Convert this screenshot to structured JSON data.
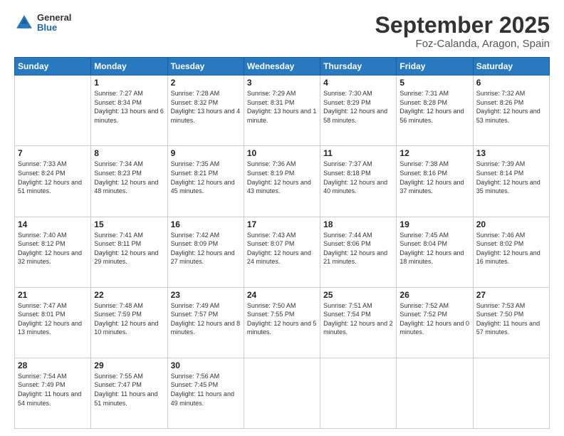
{
  "header": {
    "logo_general": "General",
    "logo_blue": "Blue",
    "month": "September 2025",
    "location": "Foz-Calanda, Aragon, Spain"
  },
  "weekdays": [
    "Sunday",
    "Monday",
    "Tuesday",
    "Wednesday",
    "Thursday",
    "Friday",
    "Saturday"
  ],
  "weeks": [
    [
      {
        "day": "",
        "sunrise": "",
        "sunset": "",
        "daylight": ""
      },
      {
        "day": "1",
        "sunrise": "Sunrise: 7:27 AM",
        "sunset": "Sunset: 8:34 PM",
        "daylight": "Daylight: 13 hours and 6 minutes."
      },
      {
        "day": "2",
        "sunrise": "Sunrise: 7:28 AM",
        "sunset": "Sunset: 8:32 PM",
        "daylight": "Daylight: 13 hours and 4 minutes."
      },
      {
        "day": "3",
        "sunrise": "Sunrise: 7:29 AM",
        "sunset": "Sunset: 8:31 PM",
        "daylight": "Daylight: 13 hours and 1 minute."
      },
      {
        "day": "4",
        "sunrise": "Sunrise: 7:30 AM",
        "sunset": "Sunset: 8:29 PM",
        "daylight": "Daylight: 12 hours and 58 minutes."
      },
      {
        "day": "5",
        "sunrise": "Sunrise: 7:31 AM",
        "sunset": "Sunset: 8:28 PM",
        "daylight": "Daylight: 12 hours and 56 minutes."
      },
      {
        "day": "6",
        "sunrise": "Sunrise: 7:32 AM",
        "sunset": "Sunset: 8:26 PM",
        "daylight": "Daylight: 12 hours and 53 minutes."
      }
    ],
    [
      {
        "day": "7",
        "sunrise": "Sunrise: 7:33 AM",
        "sunset": "Sunset: 8:24 PM",
        "daylight": "Daylight: 12 hours and 51 minutes."
      },
      {
        "day": "8",
        "sunrise": "Sunrise: 7:34 AM",
        "sunset": "Sunset: 8:23 PM",
        "daylight": "Daylight: 12 hours and 48 minutes."
      },
      {
        "day": "9",
        "sunrise": "Sunrise: 7:35 AM",
        "sunset": "Sunset: 8:21 PM",
        "daylight": "Daylight: 12 hours and 45 minutes."
      },
      {
        "day": "10",
        "sunrise": "Sunrise: 7:36 AM",
        "sunset": "Sunset: 8:19 PM",
        "daylight": "Daylight: 12 hours and 43 minutes."
      },
      {
        "day": "11",
        "sunrise": "Sunrise: 7:37 AM",
        "sunset": "Sunset: 8:18 PM",
        "daylight": "Daylight: 12 hours and 40 minutes."
      },
      {
        "day": "12",
        "sunrise": "Sunrise: 7:38 AM",
        "sunset": "Sunset: 8:16 PM",
        "daylight": "Daylight: 12 hours and 37 minutes."
      },
      {
        "day": "13",
        "sunrise": "Sunrise: 7:39 AM",
        "sunset": "Sunset: 8:14 PM",
        "daylight": "Daylight: 12 hours and 35 minutes."
      }
    ],
    [
      {
        "day": "14",
        "sunrise": "Sunrise: 7:40 AM",
        "sunset": "Sunset: 8:12 PM",
        "daylight": "Daylight: 12 hours and 32 minutes."
      },
      {
        "day": "15",
        "sunrise": "Sunrise: 7:41 AM",
        "sunset": "Sunset: 8:11 PM",
        "daylight": "Daylight: 12 hours and 29 minutes."
      },
      {
        "day": "16",
        "sunrise": "Sunrise: 7:42 AM",
        "sunset": "Sunset: 8:09 PM",
        "daylight": "Daylight: 12 hours and 27 minutes."
      },
      {
        "day": "17",
        "sunrise": "Sunrise: 7:43 AM",
        "sunset": "Sunset: 8:07 PM",
        "daylight": "Daylight: 12 hours and 24 minutes."
      },
      {
        "day": "18",
        "sunrise": "Sunrise: 7:44 AM",
        "sunset": "Sunset: 8:06 PM",
        "daylight": "Daylight: 12 hours and 21 minutes."
      },
      {
        "day": "19",
        "sunrise": "Sunrise: 7:45 AM",
        "sunset": "Sunset: 8:04 PM",
        "daylight": "Daylight: 12 hours and 18 minutes."
      },
      {
        "day": "20",
        "sunrise": "Sunrise: 7:46 AM",
        "sunset": "Sunset: 8:02 PM",
        "daylight": "Daylight: 12 hours and 16 minutes."
      }
    ],
    [
      {
        "day": "21",
        "sunrise": "Sunrise: 7:47 AM",
        "sunset": "Sunset: 8:01 PM",
        "daylight": "Daylight: 12 hours and 13 minutes."
      },
      {
        "day": "22",
        "sunrise": "Sunrise: 7:48 AM",
        "sunset": "Sunset: 7:59 PM",
        "daylight": "Daylight: 12 hours and 10 minutes."
      },
      {
        "day": "23",
        "sunrise": "Sunrise: 7:49 AM",
        "sunset": "Sunset: 7:57 PM",
        "daylight": "Daylight: 12 hours and 8 minutes."
      },
      {
        "day": "24",
        "sunrise": "Sunrise: 7:50 AM",
        "sunset": "Sunset: 7:55 PM",
        "daylight": "Daylight: 12 hours and 5 minutes."
      },
      {
        "day": "25",
        "sunrise": "Sunrise: 7:51 AM",
        "sunset": "Sunset: 7:54 PM",
        "daylight": "Daylight: 12 hours and 2 minutes."
      },
      {
        "day": "26",
        "sunrise": "Sunrise: 7:52 AM",
        "sunset": "Sunset: 7:52 PM",
        "daylight": "Daylight: 12 hours and 0 minutes."
      },
      {
        "day": "27",
        "sunrise": "Sunrise: 7:53 AM",
        "sunset": "Sunset: 7:50 PM",
        "daylight": "Daylight: 11 hours and 57 minutes."
      }
    ],
    [
      {
        "day": "28",
        "sunrise": "Sunrise: 7:54 AM",
        "sunset": "Sunset: 7:49 PM",
        "daylight": "Daylight: 11 hours and 54 minutes."
      },
      {
        "day": "29",
        "sunrise": "Sunrise: 7:55 AM",
        "sunset": "Sunset: 7:47 PM",
        "daylight": "Daylight: 11 hours and 51 minutes."
      },
      {
        "day": "30",
        "sunrise": "Sunrise: 7:56 AM",
        "sunset": "Sunset: 7:45 PM",
        "daylight": "Daylight: 11 hours and 49 minutes."
      },
      {
        "day": "",
        "sunrise": "",
        "sunset": "",
        "daylight": ""
      },
      {
        "day": "",
        "sunrise": "",
        "sunset": "",
        "daylight": ""
      },
      {
        "day": "",
        "sunrise": "",
        "sunset": "",
        "daylight": ""
      },
      {
        "day": "",
        "sunrise": "",
        "sunset": "",
        "daylight": ""
      }
    ]
  ]
}
